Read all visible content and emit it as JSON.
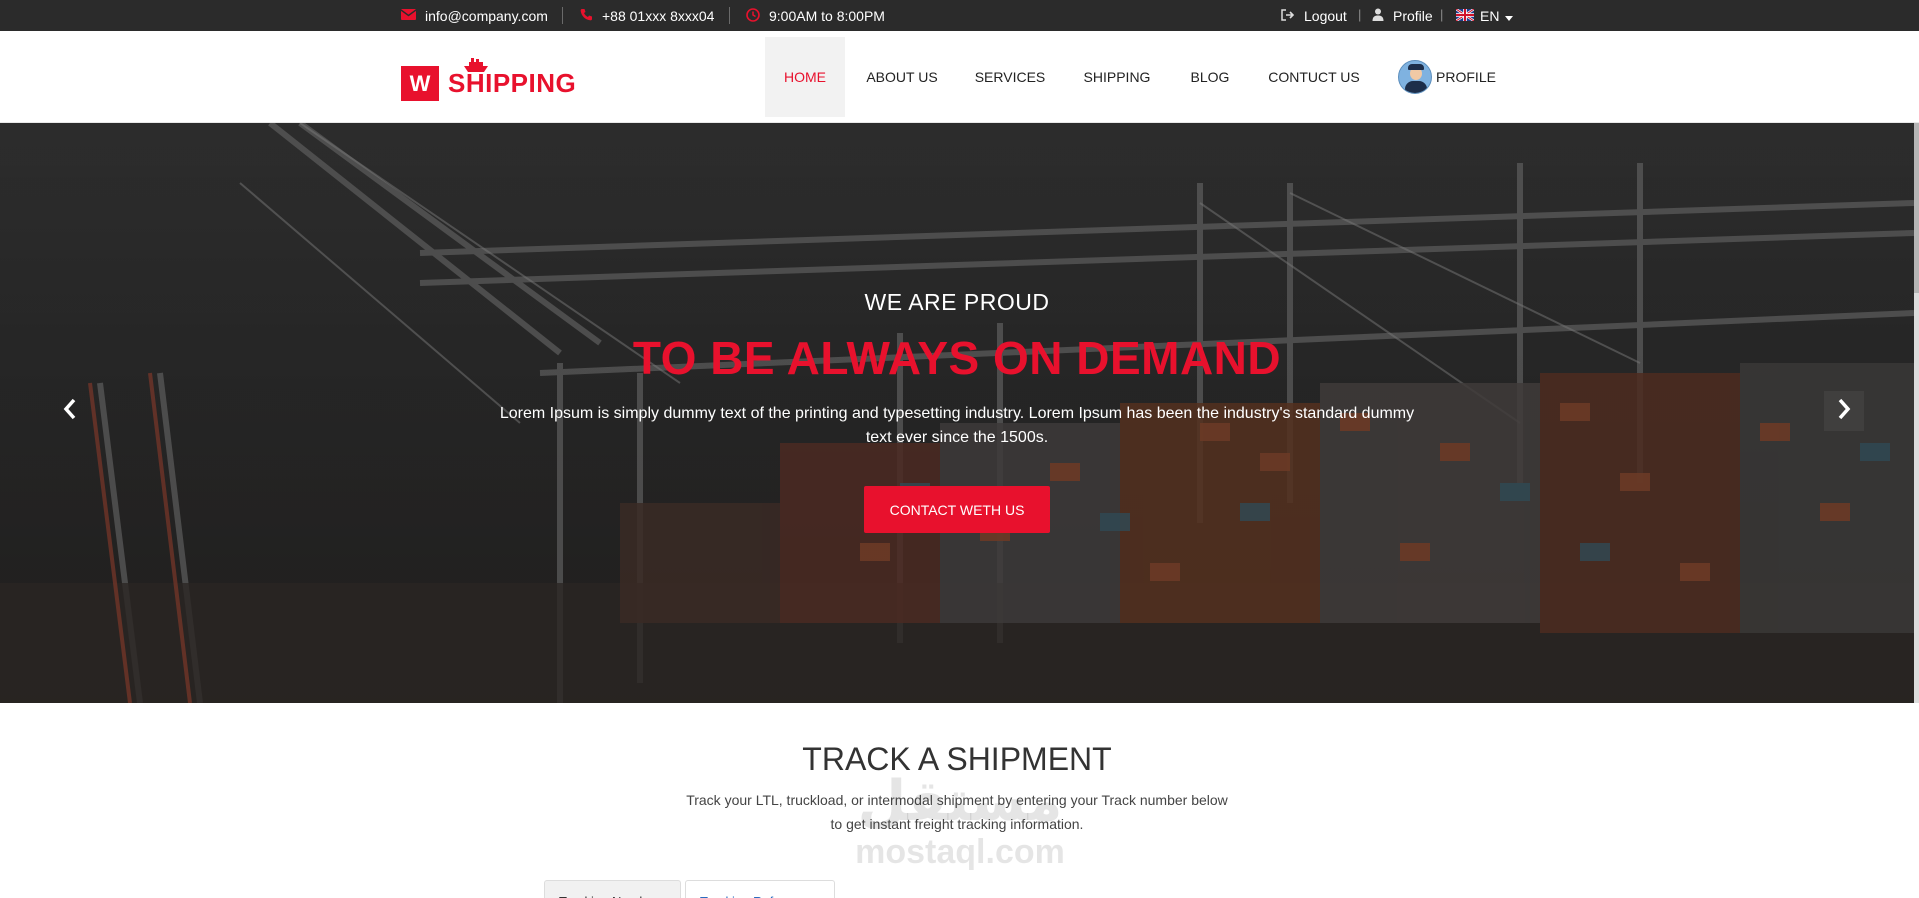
{
  "topbar": {
    "email": "info@company.com",
    "phone": "+88 01xxx 8xxx04",
    "hours": "9:00AM to 8:00PM",
    "logout": "Logout",
    "profile": "Profile",
    "sep": "|",
    "language": "EN"
  },
  "logo": {
    "letter": "W",
    "text": "SHIPPING"
  },
  "nav": {
    "items": [
      "HOME",
      "ABOUT US",
      "SERVICES",
      "SHIPPING",
      "BLOG",
      "CONTUCT US"
    ],
    "profile": "PROFILE",
    "active": "HOME"
  },
  "hero": {
    "subtitle": "WE ARE PROUD",
    "title": "TO BE ALWAYS ON DEMAND",
    "text": "Lorem Ipsum is simply dummy text of the printing and typesetting industry. Lorem Ipsum has been the industry's standard dummy text ever since the 1500s.",
    "button": "CONTACT WETH US"
  },
  "track": {
    "title": "TRACK A SHIPMENT",
    "description_line1": "Track your LTL, truckload, or intermodal shipment by entering your Track number below",
    "description_line2": "to get instant freight tracking information.",
    "tabs": [
      "Tracking Number",
      "Tracking Reference"
    ]
  },
  "watermark": {
    "arabic": "مستقل",
    "latin": "mostaql.com"
  },
  "colors": {
    "brand": "#e8112d",
    "topbar": "#2b2b2b"
  }
}
